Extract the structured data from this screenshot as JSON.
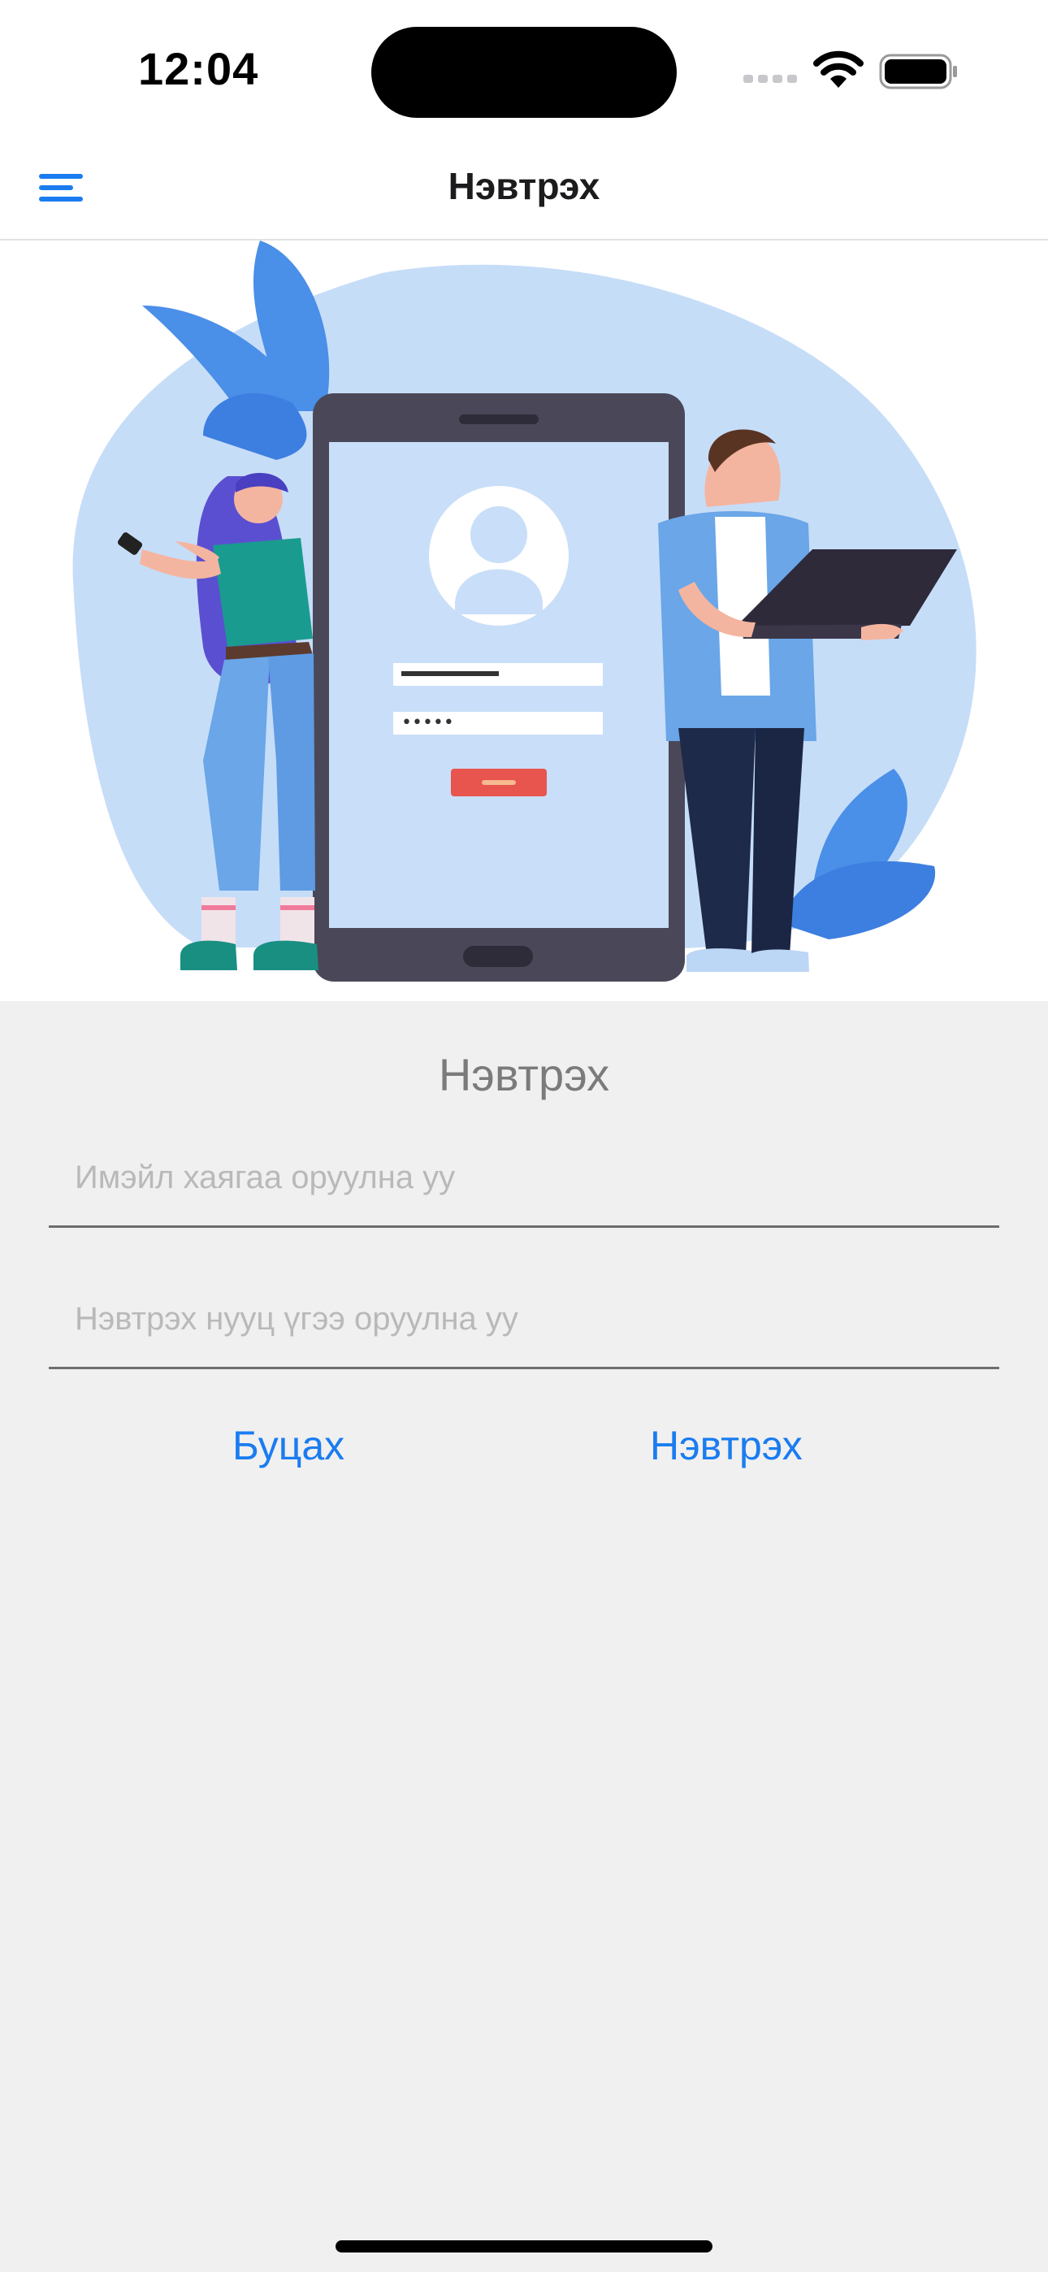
{
  "status": {
    "time": "12:04"
  },
  "nav": {
    "title": "Нэвтрэх",
    "menu_icon": "hamburger-menu-icon"
  },
  "form": {
    "title": "Нэвтрэх",
    "email_placeholder": "Имэйл хаягаа оруулна уу",
    "email_value": "",
    "password_placeholder": "Нэвтрэх нууц үгээ оруулна уу",
    "password_value": "",
    "back_label": "Буцах",
    "login_label": "Нэвтрэх"
  },
  "colors": {
    "accent": "#1a7cf0",
    "background": "#f0f0f0",
    "hero_blob": "#c6ddf8"
  }
}
